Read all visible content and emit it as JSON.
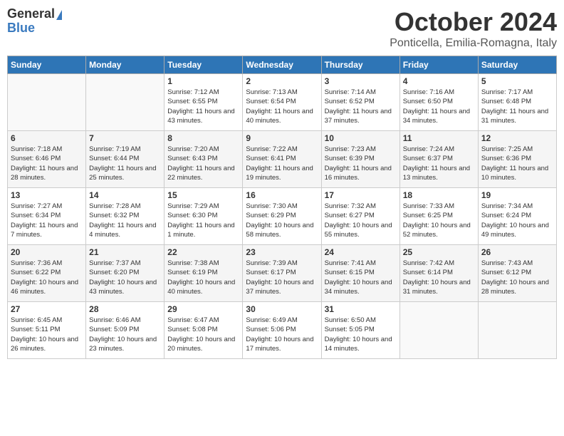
{
  "header": {
    "logo_general": "General",
    "logo_blue": "Blue",
    "month": "October 2024",
    "location": "Ponticella, Emilia-Romagna, Italy"
  },
  "days_of_week": [
    "Sunday",
    "Monday",
    "Tuesday",
    "Wednesday",
    "Thursday",
    "Friday",
    "Saturday"
  ],
  "weeks": [
    [
      {
        "day": "",
        "info": ""
      },
      {
        "day": "",
        "info": ""
      },
      {
        "day": "1",
        "info": "Sunrise: 7:12 AM\nSunset: 6:55 PM\nDaylight: 11 hours and 43 minutes."
      },
      {
        "day": "2",
        "info": "Sunrise: 7:13 AM\nSunset: 6:54 PM\nDaylight: 11 hours and 40 minutes."
      },
      {
        "day": "3",
        "info": "Sunrise: 7:14 AM\nSunset: 6:52 PM\nDaylight: 11 hours and 37 minutes."
      },
      {
        "day": "4",
        "info": "Sunrise: 7:16 AM\nSunset: 6:50 PM\nDaylight: 11 hours and 34 minutes."
      },
      {
        "day": "5",
        "info": "Sunrise: 7:17 AM\nSunset: 6:48 PM\nDaylight: 11 hours and 31 minutes."
      }
    ],
    [
      {
        "day": "6",
        "info": "Sunrise: 7:18 AM\nSunset: 6:46 PM\nDaylight: 11 hours and 28 minutes."
      },
      {
        "day": "7",
        "info": "Sunrise: 7:19 AM\nSunset: 6:44 PM\nDaylight: 11 hours and 25 minutes."
      },
      {
        "day": "8",
        "info": "Sunrise: 7:20 AM\nSunset: 6:43 PM\nDaylight: 11 hours and 22 minutes."
      },
      {
        "day": "9",
        "info": "Sunrise: 7:22 AM\nSunset: 6:41 PM\nDaylight: 11 hours and 19 minutes."
      },
      {
        "day": "10",
        "info": "Sunrise: 7:23 AM\nSunset: 6:39 PM\nDaylight: 11 hours and 16 minutes."
      },
      {
        "day": "11",
        "info": "Sunrise: 7:24 AM\nSunset: 6:37 PM\nDaylight: 11 hours and 13 minutes."
      },
      {
        "day": "12",
        "info": "Sunrise: 7:25 AM\nSunset: 6:36 PM\nDaylight: 11 hours and 10 minutes."
      }
    ],
    [
      {
        "day": "13",
        "info": "Sunrise: 7:27 AM\nSunset: 6:34 PM\nDaylight: 11 hours and 7 minutes."
      },
      {
        "day": "14",
        "info": "Sunrise: 7:28 AM\nSunset: 6:32 PM\nDaylight: 11 hours and 4 minutes."
      },
      {
        "day": "15",
        "info": "Sunrise: 7:29 AM\nSunset: 6:30 PM\nDaylight: 11 hours and 1 minute."
      },
      {
        "day": "16",
        "info": "Sunrise: 7:30 AM\nSunset: 6:29 PM\nDaylight: 10 hours and 58 minutes."
      },
      {
        "day": "17",
        "info": "Sunrise: 7:32 AM\nSunset: 6:27 PM\nDaylight: 10 hours and 55 minutes."
      },
      {
        "day": "18",
        "info": "Sunrise: 7:33 AM\nSunset: 6:25 PM\nDaylight: 10 hours and 52 minutes."
      },
      {
        "day": "19",
        "info": "Sunrise: 7:34 AM\nSunset: 6:24 PM\nDaylight: 10 hours and 49 minutes."
      }
    ],
    [
      {
        "day": "20",
        "info": "Sunrise: 7:36 AM\nSunset: 6:22 PM\nDaylight: 10 hours and 46 minutes."
      },
      {
        "day": "21",
        "info": "Sunrise: 7:37 AM\nSunset: 6:20 PM\nDaylight: 10 hours and 43 minutes."
      },
      {
        "day": "22",
        "info": "Sunrise: 7:38 AM\nSunset: 6:19 PM\nDaylight: 10 hours and 40 minutes."
      },
      {
        "day": "23",
        "info": "Sunrise: 7:39 AM\nSunset: 6:17 PM\nDaylight: 10 hours and 37 minutes."
      },
      {
        "day": "24",
        "info": "Sunrise: 7:41 AM\nSunset: 6:15 PM\nDaylight: 10 hours and 34 minutes."
      },
      {
        "day": "25",
        "info": "Sunrise: 7:42 AM\nSunset: 6:14 PM\nDaylight: 10 hours and 31 minutes."
      },
      {
        "day": "26",
        "info": "Sunrise: 7:43 AM\nSunset: 6:12 PM\nDaylight: 10 hours and 28 minutes."
      }
    ],
    [
      {
        "day": "27",
        "info": "Sunrise: 6:45 AM\nSunset: 5:11 PM\nDaylight: 10 hours and 26 minutes."
      },
      {
        "day": "28",
        "info": "Sunrise: 6:46 AM\nSunset: 5:09 PM\nDaylight: 10 hours and 23 minutes."
      },
      {
        "day": "29",
        "info": "Sunrise: 6:47 AM\nSunset: 5:08 PM\nDaylight: 10 hours and 20 minutes."
      },
      {
        "day": "30",
        "info": "Sunrise: 6:49 AM\nSunset: 5:06 PM\nDaylight: 10 hours and 17 minutes."
      },
      {
        "day": "31",
        "info": "Sunrise: 6:50 AM\nSunset: 5:05 PM\nDaylight: 10 hours and 14 minutes."
      },
      {
        "day": "",
        "info": ""
      },
      {
        "day": "",
        "info": ""
      }
    ]
  ]
}
